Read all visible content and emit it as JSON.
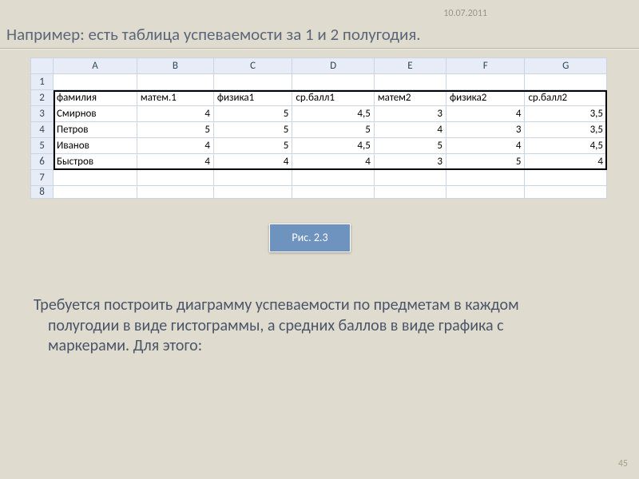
{
  "meta": {
    "date": "10.07.2011",
    "page_number": "45"
  },
  "title": "Например: есть таблица успеваемости за 1 и 2 полугодия.",
  "figure_label": "Рис. 2.3",
  "body_text": "Требуется построить диаграмму успеваемости по предметам в каждом полугодии в виде гистограммы, а средних баллов в виде графика с маркерами. Для этого:",
  "spreadsheet": {
    "columns": [
      "A",
      "B",
      "C",
      "D",
      "E",
      "F",
      "G"
    ],
    "row_numbers": [
      "1",
      "2",
      "3",
      "4",
      "5",
      "6",
      "7",
      "8"
    ],
    "headers": [
      "фамилия",
      "матем.1",
      "физика1",
      "ср.балл1",
      "матем2",
      "физика2",
      "ср.балл2"
    ],
    "rows": [
      {
        "name": "Смирнов",
        "m1": "4",
        "p1": "5",
        "a1": "4,5",
        "m2": "3",
        "p2": "4",
        "a2": "3,5"
      },
      {
        "name": "Петров",
        "m1": "5",
        "p1": "5",
        "a1": "5",
        "m2": "4",
        "p2": "3",
        "a2": "3,5"
      },
      {
        "name": "Иванов",
        "m1": "4",
        "p1": "5",
        "a1": "4,5",
        "m2": "5",
        "p2": "4",
        "a2": "4,5"
      },
      {
        "name": "Быстров",
        "m1": "4",
        "p1": "4",
        "a1": "4",
        "m2": "3",
        "p2": "5",
        "a2": "4"
      }
    ]
  }
}
